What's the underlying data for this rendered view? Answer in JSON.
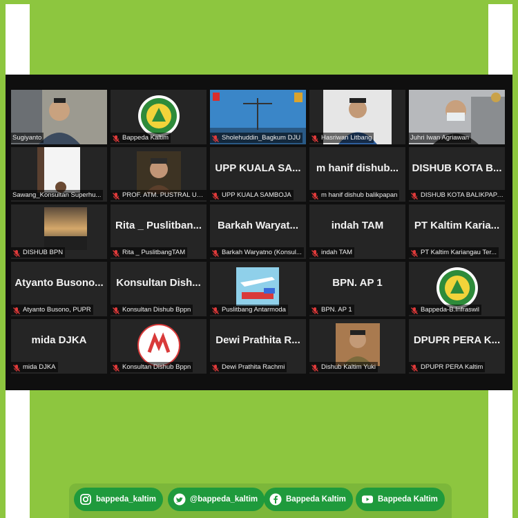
{
  "participants": [
    {
      "name": "Sugiyanto",
      "display_text": "",
      "muted": false
    },
    {
      "name": "Bappeda Kaltim",
      "display_text": "",
      "muted": true
    },
    {
      "name": "Sholehuddin_Bagkum DJU",
      "display_text": "",
      "muted": true
    },
    {
      "name": "Hasriwan Litbang",
      "display_text": "",
      "muted": true
    },
    {
      "name": "Juhri Iwan Agriawan",
      "display_text": "",
      "muted": false
    },
    {
      "name": "Sawang_Konsultan Superhu...",
      "display_text": "",
      "muted": false
    },
    {
      "name": "PROF. ATM. PUSTRAL UG...",
      "display_text": "",
      "muted": true
    },
    {
      "name": "UPP KUALA SAMBOJA",
      "display_text": "UPP KUALA SA...",
      "muted": true
    },
    {
      "name": "m hanif dishub balikpapan",
      "display_text": "m hanif dishub...",
      "muted": true
    },
    {
      "name": "DISHUB KOTA BALIKPAPAN",
      "display_text": "DISHUB KOTA B...",
      "muted": true
    },
    {
      "name": "DISHUB BPN",
      "display_text": "",
      "muted": true
    },
    {
      "name": "Rita _ PuslitbangTAM",
      "display_text": "Rita _ Puslitban...",
      "muted": true
    },
    {
      "name": "Barkah Waryatno (Konsul...",
      "display_text": "Barkah Waryat...",
      "muted": true
    },
    {
      "name": "indah TAM",
      "display_text": "indah TAM",
      "muted": true
    },
    {
      "name": "PT Kaltim Kariangau Ter...",
      "display_text": "PT Kaltim Karia...",
      "muted": true
    },
    {
      "name": "Atyanto Busono, PUPR",
      "display_text": "Atyanto Busono...",
      "muted": true
    },
    {
      "name": "Konsultan Dishub Bppn",
      "display_text": "Konsultan Dish...",
      "muted": true
    },
    {
      "name": "Puslitbang Antarmoda",
      "display_text": "",
      "muted": true
    },
    {
      "name": "BPN. AP 1",
      "display_text": "BPN. AP 1",
      "muted": true
    },
    {
      "name": "Bappeda-B.Infraswil",
      "display_text": "",
      "muted": true
    },
    {
      "name": "mida DJKA",
      "display_text": "mida DJKA",
      "muted": true
    },
    {
      "name": "Konsultan Dishub Bppn",
      "display_text": "",
      "muted": true
    },
    {
      "name": "Dewi Prathita Rachmi",
      "display_text": "Dewi Prathita R...",
      "muted": true
    },
    {
      "name": "Dishub Kaltim Yuki",
      "display_text": "",
      "muted": true
    },
    {
      "name": "DPUPR PERA Kaltim",
      "display_text": "DPUPR PERA K...",
      "muted": true
    }
  ],
  "social": {
    "instagram": "bappeda_kaltim",
    "twitter": "@bappeda_kaltim",
    "facebook": "Bappeda Kaltim",
    "youtube": "Bappeda Kaltim"
  },
  "colors": {
    "frame_green": "#8dc63f",
    "pill_green": "#1f9a3c",
    "active_speaker": "#f5d94a",
    "tile_bg": "#252525",
    "mute_red": "#e03a3a"
  }
}
